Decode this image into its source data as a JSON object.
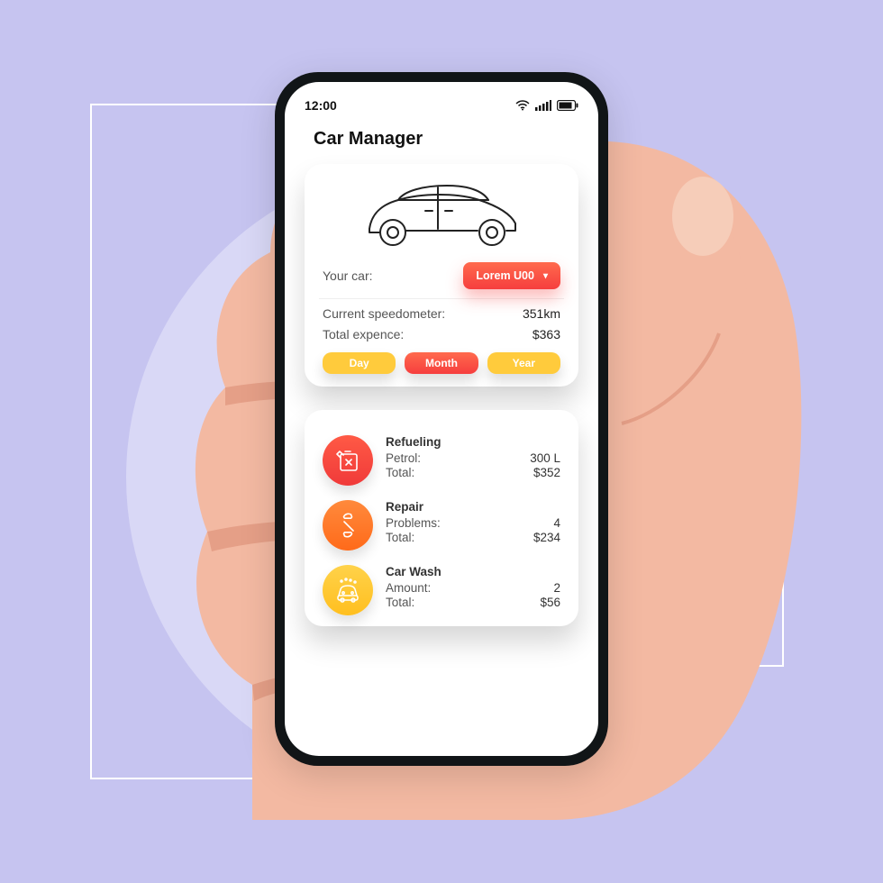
{
  "statusbar": {
    "time": "12:00"
  },
  "app": {
    "title": "Car Manager"
  },
  "summary": {
    "your_car_label": "Your car:",
    "car_selected": "Lorem U00",
    "speedometer_label": "Current speedometer:",
    "speedometer_value": "351km",
    "expense_label": "Total expence:",
    "expense_value": "$363",
    "periods": {
      "day": "Day",
      "month": "Month",
      "year": "Year"
    },
    "selected_period": "month"
  },
  "expenses": {
    "refueling": {
      "title": "Refueling",
      "line1_label": "Petrol:",
      "line1_value": "300 L",
      "line2_label": "Total:",
      "line2_value": "$352"
    },
    "repair": {
      "title": "Repair",
      "line1_label": "Problems:",
      "line1_value": "4",
      "line2_label": "Total:",
      "line2_value": "$234"
    },
    "carwash": {
      "title": "Car Wash",
      "line1_label": "Amount:",
      "line1_value": "2",
      "line2_label": "Total:",
      "line2_value": "$56"
    }
  },
  "colors": {
    "bg": "#c6c4f0",
    "circle": "#d9d8f6",
    "red_grad_top": "#ff6a4d",
    "red_grad_bot": "#f63e3e",
    "yellow": "#ffcb3c",
    "orange": "#ff7a28"
  },
  "icons": {
    "wifi": "wifi-icon",
    "signal": "signal-icon",
    "battery": "battery-icon",
    "car": "car-outline-icon",
    "chevron_down": "chevron-down-icon",
    "fuel_can": "fuel-can-icon",
    "wrench": "wrench-icon",
    "car_wash": "car-wash-icon"
  }
}
